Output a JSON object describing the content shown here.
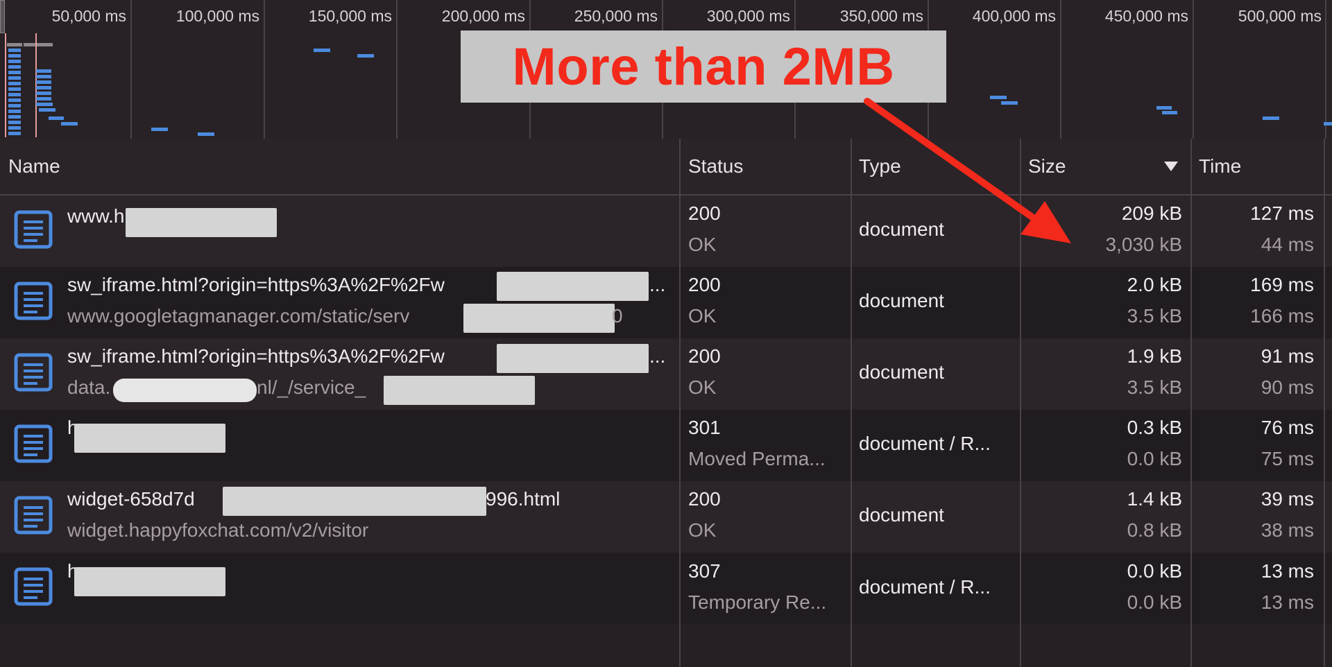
{
  "timeline": {
    "ticks": [
      "50,000 ms",
      "100,000 ms",
      "150,000 ms",
      "200,000 ms",
      "250,000 ms",
      "300,000 ms",
      "350,000 ms",
      "400,000 ms",
      "450,000 ms",
      "500,000 ms"
    ]
  },
  "columns": {
    "name": "Name",
    "status": "Status",
    "type": "Type",
    "size": "Size",
    "time": "Time"
  },
  "rows": [
    {
      "name": "www.h",
      "subname": "",
      "status": "200",
      "status_text": "OK",
      "type": "document",
      "size": "209 kB",
      "resource_size": "3,030 kB",
      "time": "127 ms",
      "latency": "44 ms"
    },
    {
      "name": "sw_iframe.html?origin=https%3A%2F%2Fw",
      "name_suffix": "...",
      "subname": "www.googletagmanager.com/static/serv",
      "subname_suffix": "0",
      "status": "200",
      "status_text": "OK",
      "type": "document",
      "size": "2.0 kB",
      "resource_size": "3.5 kB",
      "time": "169 ms",
      "latency": "166 ms"
    },
    {
      "name": "sw_iframe.html?origin=https%3A%2F%2Fw",
      "name_suffix": "...",
      "subname": "data.",
      "subname_mid": "nl/_/service_",
      "status": "200",
      "status_text": "OK",
      "type": "document",
      "size": "1.9 kB",
      "resource_size": "3.5 kB",
      "time": "91 ms",
      "latency": "90 ms"
    },
    {
      "name": "h",
      "subname": "",
      "status": "301",
      "status_text": "Moved Perma...",
      "type": "document / R...",
      "size": "0.3 kB",
      "resource_size": "0.0 kB",
      "time": "76 ms",
      "latency": "75 ms"
    },
    {
      "name": "widget-658d7d",
      "name_suffix": "996.html",
      "subname": "widget.happyfoxchat.com/v2/visitor",
      "status": "200",
      "status_text": "OK",
      "type": "document",
      "size": "1.4 kB",
      "resource_size": "0.8 kB",
      "time": "39 ms",
      "latency": "38 ms"
    },
    {
      "name": "h",
      "subname": "",
      "status": "307",
      "status_text": "Temporary Re...",
      "type": "document / R...",
      "size": "0.0 kB",
      "resource_size": "0.0 kB",
      "time": "13 ms",
      "latency": "13 ms"
    }
  ],
  "annotation": {
    "text": "More than 2MB",
    "text_color": "#f3291b",
    "box_color": "#c6c6c6",
    "arrow_color": "#f3291b"
  },
  "icons": {
    "row_icon": "document-icon",
    "sort_icon": "sort-descending-icon"
  },
  "colors": {
    "waterfall_bar": "#4c8bdf",
    "document_icon": "#4c8bdf"
  }
}
